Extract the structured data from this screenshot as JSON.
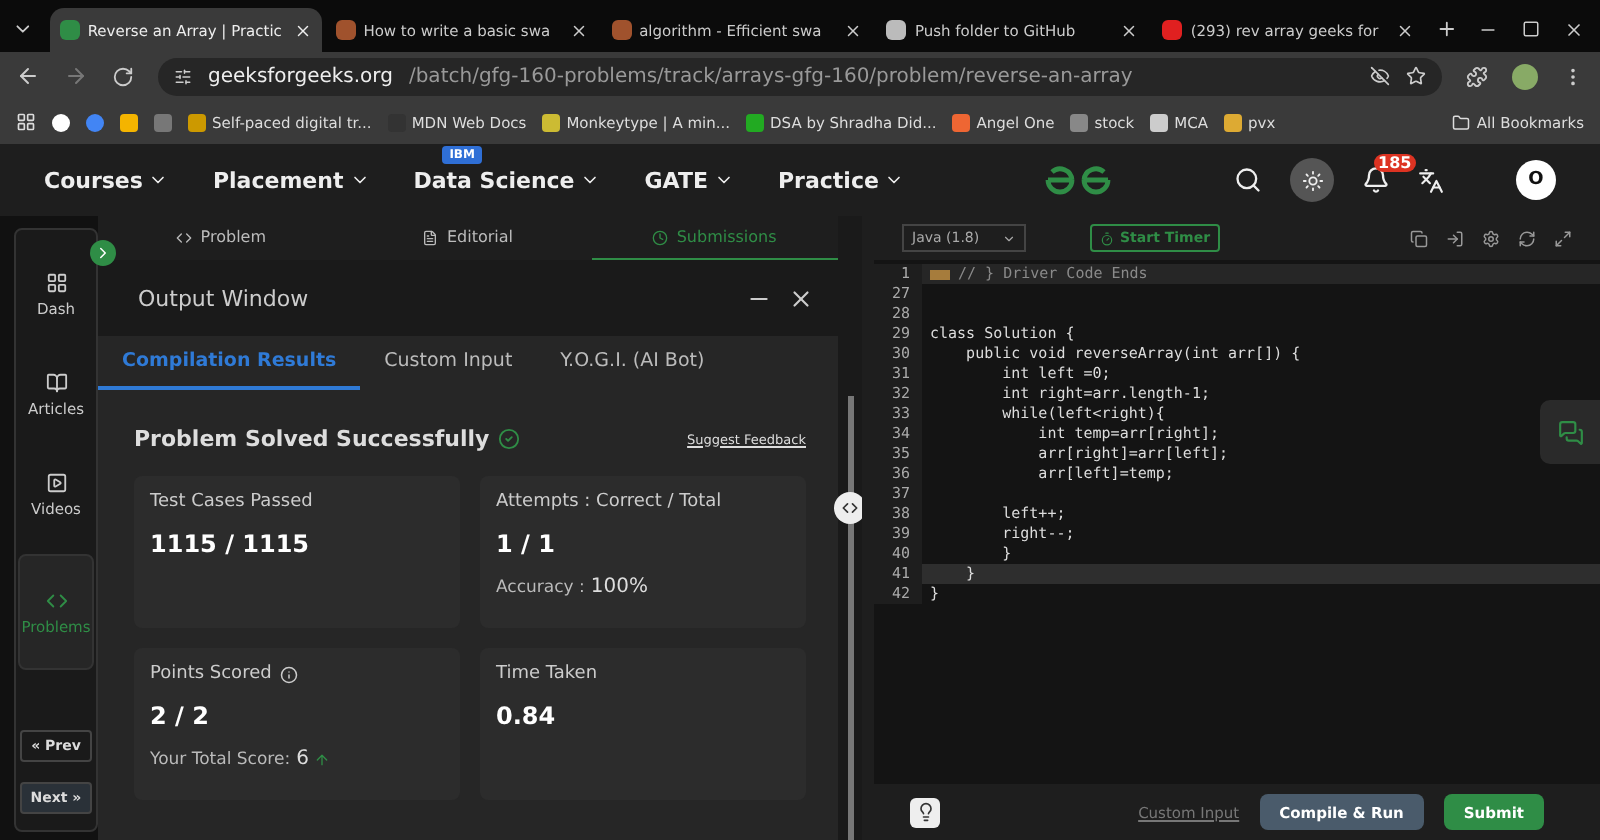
{
  "browser_tabs": [
    {
      "title": "Reverse an Array | Practic",
      "selected": true
    },
    {
      "title": "How to write a basic swa",
      "selected": false
    },
    {
      "title": "algorithm - Efficient swa",
      "selected": false
    },
    {
      "title": "Push folder to GitHub",
      "selected": false
    },
    {
      "title": "(293) rev array geeks for",
      "selected": false
    }
  ],
  "address_bar": {
    "domain": "geeksforgeeks.org",
    "path": "/batch/gfg-160-problems/track/arrays-gfg-160/problem/reverse-an-array"
  },
  "bookmarks": [
    {
      "label": "Self-paced digital tr..."
    },
    {
      "label": "MDN Web Docs"
    },
    {
      "label": "Monkeytype | A min..."
    },
    {
      "label": "DSA by Shradha Did..."
    },
    {
      "label": "Angel One"
    },
    {
      "label": "stock"
    },
    {
      "label": "MCA"
    },
    {
      "label": "pvx"
    }
  ],
  "all_bookmarks": "All Bookmarks",
  "site_nav": {
    "items": [
      {
        "label": "Courses"
      },
      {
        "label": "Placement"
      },
      {
        "label": "Data Science",
        "badge": "IBM"
      },
      {
        "label": "GATE"
      },
      {
        "label": "Practice"
      }
    ],
    "notifications": "185",
    "avatar": "O"
  },
  "sidebar": {
    "items": [
      {
        "label": "Dash",
        "selected": false
      },
      {
        "label": "Articles",
        "selected": false
      },
      {
        "label": "Videos",
        "selected": false
      },
      {
        "label": "Problems",
        "selected": true
      }
    ],
    "prev": "« Prev",
    "next": "Next »"
  },
  "problem_tabs": [
    {
      "label": "Problem",
      "selected": false
    },
    {
      "label": "Editorial",
      "selected": false
    },
    {
      "label": "Submissions",
      "selected": true
    }
  ],
  "output_window": {
    "title": "Output Window",
    "tabs": [
      {
        "label": "Compilation Results",
        "selected": true
      },
      {
        "label": "Custom Input",
        "selected": false
      },
      {
        "label": "Y.O.G.I. (AI Bot)",
        "selected": false
      }
    ],
    "status": "Problem Solved Successfully",
    "feedback_link": "Suggest Feedback",
    "cards": [
      {
        "label": "Test Cases Passed",
        "value": "1115 / 1115"
      },
      {
        "label": "Attempts : Correct / Total",
        "value": "1 / 1",
        "note_label": "Accuracy :",
        "note_value": "100%"
      },
      {
        "label": "Points Scored",
        "value": "2 / 2",
        "info": true,
        "note_label": "Your Total Score:",
        "note_value": "6",
        "trend_up": true
      },
      {
        "label": "Time Taken",
        "value": "0.84"
      }
    ]
  },
  "editor": {
    "language": "Java (1.8)",
    "timer": "Start Timer",
    "lines": [
      {
        "number": "1",
        "text": "// } Driver Code Ends",
        "folded": true,
        "current": false
      },
      {
        "number": "27",
        "current": false
      },
      {
        "number": "28",
        "current": false
      },
      {
        "number": "29",
        "text": "class Solution {",
        "current": false
      },
      {
        "number": "30",
        "text": "    public void reverseArray(int arr[]) {",
        "current": false
      },
      {
        "number": "31",
        "text": "        int left =0;",
        "current": false
      },
      {
        "number": "32",
        "text": "        int right=arr.length-1;",
        "current": false
      },
      {
        "number": "33",
        "text": "        while(left<right){",
        "current": false
      },
      {
        "number": "34",
        "text": "            int temp=arr[right];",
        "current": false
      },
      {
        "number": "35",
        "text": "            arr[right]=arr[left];",
        "current": false
      },
      {
        "number": "36",
        "text": "            arr[left]=temp;",
        "current": false
      },
      {
        "number": "37",
        "current": false
      },
      {
        "number": "38",
        "text": "        left++;",
        "current": false
      },
      {
        "number": "39",
        "text": "        right--;",
        "current": false
      },
      {
        "number": "40",
        "text": "        }",
        "current": false
      },
      {
        "number": "41",
        "text": "    }",
        "current": true
      },
      {
        "number": "42",
        "text": "}",
        "current": false
      }
    ],
    "custom_input": "Custom Input",
    "compile_button": "Compile & Run",
    "submit_button": "Submit"
  }
}
